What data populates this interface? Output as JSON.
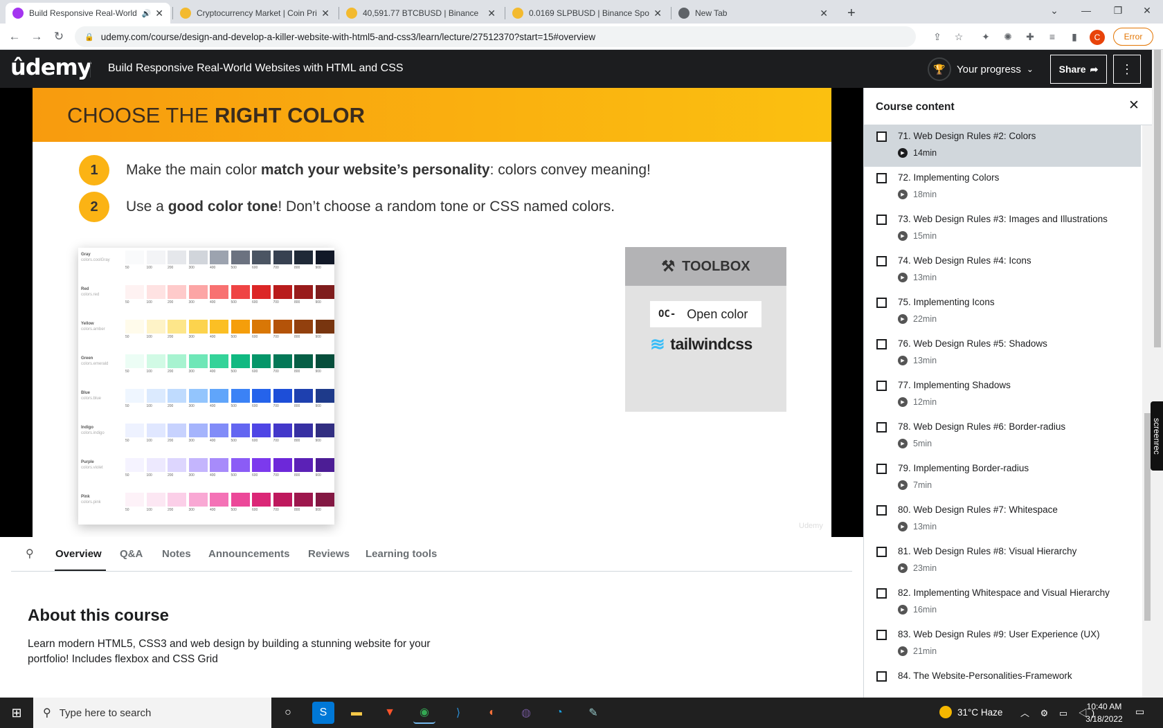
{
  "browser": {
    "tabs": [
      {
        "title": "Build Responsive Real-World",
        "active": true,
        "favicon_color": "#a435f0"
      },
      {
        "title": "Cryptocurrency Market | Coin Pric",
        "active": false,
        "favicon_color": "#f3ba2f"
      },
      {
        "title": "40,591.77   BTCBUSD | Binance",
        "active": false,
        "favicon_color": "#f3ba2f"
      },
      {
        "title": "0.0169   SLPBUSD | Binance Spo",
        "active": false,
        "favicon_color": "#f3ba2f"
      },
      {
        "title": "New Tab",
        "active": false,
        "favicon_color": "#5f6368"
      }
    ],
    "url": "udemy.com/course/design-and-develop-a-killer-website-with-html5-and-css3/learn/lecture/27512370?start=15#overview",
    "profile_initial": "C",
    "error_label": "Error"
  },
  "header": {
    "logo": "ûdemy",
    "course_title": "Build Responsive Real-World Websites with HTML and CSS",
    "progress_label": "Your progress",
    "share_label": "Share"
  },
  "slide": {
    "heading_light": "CHOOSE THE ",
    "heading_bold": "RIGHT COLOR",
    "bullets": [
      {
        "num": "1",
        "pre": "Make the main color ",
        "bold": "match your website’s personality",
        "post": ": colors convey meaning!"
      },
      {
        "num": "2",
        "pre": "Use a ",
        "bold": "good color tone",
        "post": "! Don’t choose a random tone or CSS named colors."
      }
    ],
    "toolbox_label": "TOOLBOX",
    "open_color_prefix": "OC-",
    "open_color_label": "Open color",
    "tailwind_label": "tailwindcss",
    "watermark": "Udemy",
    "palette": [
      {
        "name": "Gray",
        "sub": "colors.coolGray",
        "colors": [
          "#F9FAFB",
          "#F3F4F6",
          "#E5E7EB",
          "#D1D5DB",
          "#9CA3AF",
          "#6B7280",
          "#4B5563",
          "#374151",
          "#1F2937",
          "#111827"
        ]
      },
      {
        "name": "Red",
        "sub": "colors.red",
        "colors": [
          "#FEF2F2",
          "#FEE2E2",
          "#FECACA",
          "#FCA5A5",
          "#F87171",
          "#EF4444",
          "#DC2626",
          "#B91C1C",
          "#991B1B",
          "#7F1D1D"
        ]
      },
      {
        "name": "Yellow",
        "sub": "colors.amber",
        "colors": [
          "#FFFBEB",
          "#FEF3C7",
          "#FDE68A",
          "#FCD34D",
          "#FBBF24",
          "#F59E0B",
          "#D97706",
          "#B45309",
          "#92400E",
          "#78350F"
        ]
      },
      {
        "name": "Green",
        "sub": "colors.emerald",
        "colors": [
          "#ECFDF5",
          "#D1FAE5",
          "#A7F3D0",
          "#6EE7B7",
          "#34D399",
          "#10B981",
          "#059669",
          "#047857",
          "#065F46",
          "#064E3B"
        ]
      },
      {
        "name": "Blue",
        "sub": "colors.blue",
        "colors": [
          "#EFF6FF",
          "#DBEAFE",
          "#BFDBFE",
          "#93C5FD",
          "#60A5FA",
          "#3B82F6",
          "#2563EB",
          "#1D4ED8",
          "#1E40AF",
          "#1E3A8A"
        ]
      },
      {
        "name": "Indigo",
        "sub": "colors.indigo",
        "colors": [
          "#EEF2FF",
          "#E0E7FF",
          "#C7D2FE",
          "#A5B4FC",
          "#818CF8",
          "#6366F1",
          "#4F46E5",
          "#4338CA",
          "#3730A3",
          "#312E81"
        ]
      },
      {
        "name": "Purple",
        "sub": "colors.violet",
        "colors": [
          "#F5F3FF",
          "#EDE9FE",
          "#DDD6FE",
          "#C4B5FD",
          "#A78BFA",
          "#8B5CF6",
          "#7C3AED",
          "#6D28D9",
          "#5B21B6",
          "#4C1D95"
        ]
      },
      {
        "name": "Pink",
        "sub": "colors.pink",
        "colors": [
          "#FDF2F8",
          "#FCE7F3",
          "#FBCFE8",
          "#F9A8D4",
          "#F472B6",
          "#EC4899",
          "#DB2777",
          "#BE185D",
          "#9D174D",
          "#831843"
        ]
      }
    ],
    "shades": [
      "50",
      "100",
      "200",
      "300",
      "400",
      "500",
      "600",
      "700",
      "800",
      "900"
    ]
  },
  "content_tabs": [
    "Overview",
    "Q&A",
    "Notes",
    "Announcements",
    "Reviews",
    "Learning tools"
  ],
  "about": {
    "title": "About this course",
    "description": "Learn modern HTML5, CSS3 and web design by building a stunning website for your portfolio! Includes flexbox and CSS Grid"
  },
  "sidebar": {
    "title": "Course content",
    "items": [
      {
        "title": "71. Web Design Rules #2: Colors",
        "duration": "14min",
        "current": true
      },
      {
        "title": "72. Implementing Colors",
        "duration": "18min"
      },
      {
        "title": "73. Web Design Rules #3: Images and Illustrations",
        "duration": "15min"
      },
      {
        "title": "74. Web Design Rules #4: Icons",
        "duration": "13min"
      },
      {
        "title": "75. Implementing Icons",
        "duration": "22min"
      },
      {
        "title": "76. Web Design Rules #5: Shadows",
        "duration": "13min"
      },
      {
        "title": "77. Implementing Shadows",
        "duration": "12min"
      },
      {
        "title": "78. Web Design Rules #6: Border-radius",
        "duration": "5min"
      },
      {
        "title": "79. Implementing Border-radius",
        "duration": "7min"
      },
      {
        "title": "80. Web Design Rules #7: Whitespace",
        "duration": "13min"
      },
      {
        "title": "81. Web Design Rules #8: Visual Hierarchy",
        "duration": "23min"
      },
      {
        "title": "82. Implementing Whitespace and Visual Hierarchy",
        "duration": "16min"
      },
      {
        "title": "83. Web Design Rules #9: User Experience (UX)",
        "duration": "21min"
      },
      {
        "title": "84. The Website-Personalities-Framework",
        "duration": ""
      }
    ]
  },
  "screenrec_label": "screenrec",
  "taskbar": {
    "search_placeholder": "Type here to search",
    "weather": "31°C  Haze",
    "time": "10:40 AM",
    "date": "3/18/2022"
  }
}
